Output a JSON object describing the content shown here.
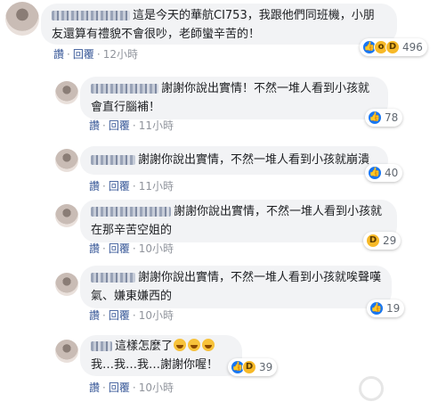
{
  "comments": [
    {
      "text": "這是今天的華航CI753，我跟他們同班機，小朋友還算有禮貌不會很吵，老師蠻辛苦的！",
      "line1": "這是今天的華航CI753，我跟他們同班機，小朋",
      "line2": "友還算有禮貌不會很吵，老師蠻辛苦的！",
      "reaction_count": "496",
      "time": "12小時"
    },
    {
      "line1": "謝謝你說出實情！不然一堆人看到小孩就",
      "line2": "會直行腦補！",
      "reaction_count": "78",
      "time": "11小時"
    },
    {
      "line1": "謝謝你說出實情，不然一堆人看到小孩就崩潰",
      "reaction_count": "40",
      "time": "11小時"
    },
    {
      "line1": "謝謝你說出實情，不然一堆人看到小孩就",
      "line2": "在那辛苦空姐的",
      "reaction_count": "29",
      "time": "10小時"
    },
    {
      "line1": "謝謝你說出實情，不然一堆人看到小孩就唉聲嘆",
      "line2": "氣、嫌東嫌西的",
      "reaction_count": "19",
      "time": "10小時"
    },
    {
      "line1": "這樣怎麼了",
      "line2": "我…我…我…謝謝你喔！",
      "reaction_count": "39",
      "time": "10小時"
    }
  ],
  "actions": {
    "like": "讚",
    "reply": "回覆",
    "separator": "·"
  },
  "colors": {
    "bubble": "#f2f3f5",
    "link": "#385898",
    "like_blue": "#1877f2",
    "emoji_yellow": "#f7b928"
  },
  "icons": {
    "like": "like-reaction-icon",
    "wow": "wow-reaction-icon",
    "haha": "haha-reaction-icon"
  }
}
